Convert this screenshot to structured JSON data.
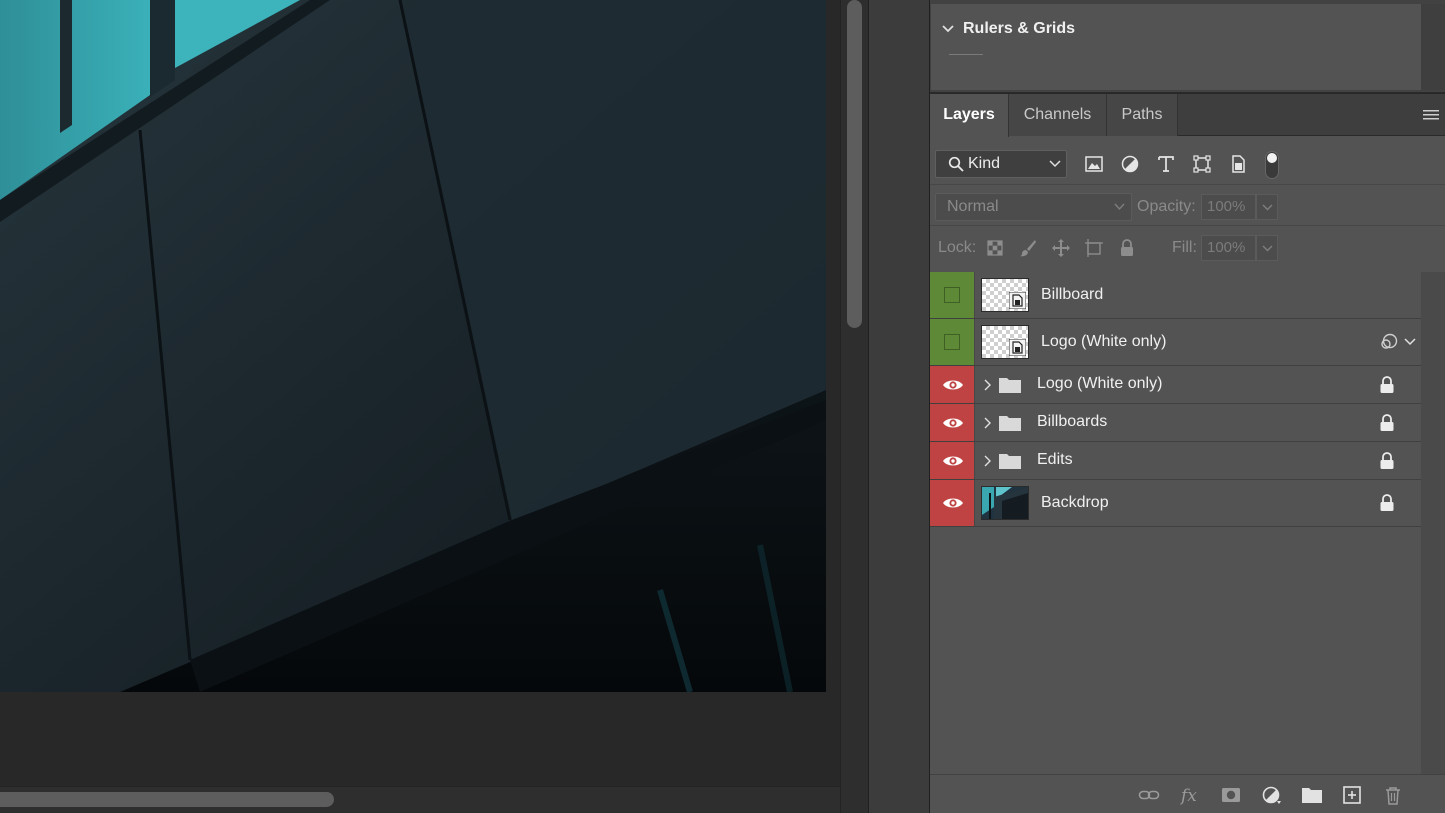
{
  "properties_panel": {
    "section_title": "Rulers & Grids"
  },
  "layers_panel": {
    "tabs": [
      {
        "label": "Layers",
        "active": true
      },
      {
        "label": "Channels",
        "active": false
      },
      {
        "label": "Paths",
        "active": false
      }
    ],
    "filter": {
      "kind_label": "Kind",
      "icons": [
        "pixel-layer-filter-icon",
        "adjustment-layer-filter-icon",
        "type-layer-filter-icon",
        "shape-layer-filter-icon",
        "smart-object-filter-icon"
      ]
    },
    "blend_mode": "Normal",
    "opacity_label": "Opacity:",
    "opacity_value": "100%",
    "lock_label": "Lock:",
    "fill_label": "Fill:",
    "fill_value": "100%",
    "layers": [
      {
        "name": "Billboard",
        "type": "smart-object",
        "visibility": "hidden",
        "tag_color": "#5e8a37"
      },
      {
        "name": "Logo (White only)",
        "type": "smart-object",
        "visibility": "hidden",
        "tag_color": "#5e8a37",
        "linked": true
      },
      {
        "name": "Logo (White only)",
        "type": "group",
        "visibility": "visible",
        "tag_color": "#bf4343",
        "locked": true
      },
      {
        "name": "Billboards",
        "type": "group",
        "visibility": "visible",
        "tag_color": "#bf4343",
        "locked": true
      },
      {
        "name": "Edits",
        "type": "group",
        "visibility": "visible",
        "tag_color": "#bf4343",
        "locked": true
      },
      {
        "name": "Backdrop",
        "type": "pixel",
        "visibility": "visible",
        "tag_color": "#bf4343",
        "locked": true
      }
    ],
    "footer_icons": [
      "link-layers-icon",
      "fx-icon",
      "add-mask-icon",
      "new-adjustment-icon",
      "new-group-icon",
      "new-layer-icon",
      "delete-layer-icon"
    ]
  },
  "colors": {
    "panel_bg": "#535353",
    "visible_tag": "#bf4343",
    "hidden_tag": "#5e8a37",
    "canvas_accent": "#3aa6b0"
  }
}
